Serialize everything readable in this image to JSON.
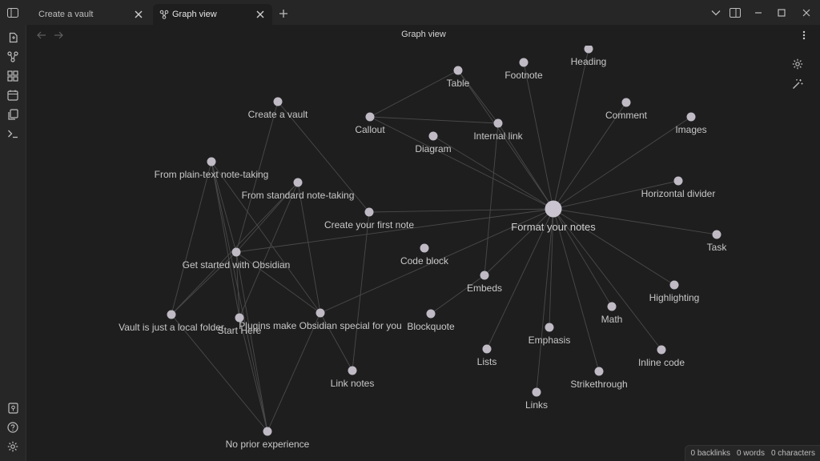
{
  "tabs": [
    {
      "label": "Create a vault",
      "active": false
    },
    {
      "label": "Graph view",
      "active": true
    }
  ],
  "view": {
    "title": "Graph view"
  },
  "icons": {
    "sidebar_toggle": "sidebar-toggle-icon",
    "graph_tab": "graph-icon",
    "ribbon": [
      "open-files-icon",
      "graph-icon",
      "canvas-icon",
      "calendar-icon",
      "copy-icon",
      "terminal-icon"
    ],
    "ribbon_bottom": [
      "vault-icon",
      "help-icon",
      "settings-icon"
    ]
  },
  "graph": {
    "hub": "Format your notes",
    "nodes": [
      {
        "id": "format",
        "label": "Format your notes"
      },
      {
        "id": "heading",
        "label": "Heading"
      },
      {
        "id": "footnote",
        "label": "Footnote"
      },
      {
        "id": "table",
        "label": "Table"
      },
      {
        "id": "comment",
        "label": "Comment"
      },
      {
        "id": "images",
        "label": "Images"
      },
      {
        "id": "callout",
        "label": "Callout"
      },
      {
        "id": "internal",
        "label": "Internal link"
      },
      {
        "id": "diagram",
        "label": "Diagram"
      },
      {
        "id": "createvault",
        "label": "Create a vault"
      },
      {
        "id": "plaintext",
        "label": "From plain-text note-taking"
      },
      {
        "id": "standard",
        "label": "From standard note-taking"
      },
      {
        "id": "firstnote",
        "label": "Create your first note"
      },
      {
        "id": "hdivider",
        "label": "Horizontal divider"
      },
      {
        "id": "task",
        "label": "Task"
      },
      {
        "id": "codeblock",
        "label": "Code block"
      },
      {
        "id": "getstarted",
        "label": "Get started with Obsidian"
      },
      {
        "id": "embeds",
        "label": "Embeds"
      },
      {
        "id": "highlighting",
        "label": "Highlighting"
      },
      {
        "id": "math",
        "label": "Math"
      },
      {
        "id": "vaultfolder",
        "label": "Vault is just a local folder"
      },
      {
        "id": "starthere",
        "label": "Start Here"
      },
      {
        "id": "plugins",
        "label": "Plugins make Obsidian special for you"
      },
      {
        "id": "blockquote",
        "label": "Blockquote"
      },
      {
        "id": "emphasis",
        "label": "Emphasis"
      },
      {
        "id": "lists",
        "label": "Lists"
      },
      {
        "id": "inlinecode",
        "label": "Inline code"
      },
      {
        "id": "linknotes",
        "label": "Link notes"
      },
      {
        "id": "strikethrough",
        "label": "Strikethrough"
      },
      {
        "id": "links",
        "label": "Links"
      },
      {
        "id": "noprior",
        "label": "No prior experience"
      }
    ],
    "edges": [
      [
        "format",
        "heading"
      ],
      [
        "format",
        "footnote"
      ],
      [
        "format",
        "table"
      ],
      [
        "format",
        "comment"
      ],
      [
        "format",
        "images"
      ],
      [
        "format",
        "callout"
      ],
      [
        "format",
        "internal"
      ],
      [
        "format",
        "diagram"
      ],
      [
        "format",
        "hdivider"
      ],
      [
        "format",
        "task"
      ],
      [
        "format",
        "embeds"
      ],
      [
        "format",
        "highlighting"
      ],
      [
        "format",
        "math"
      ],
      [
        "format",
        "emphasis"
      ],
      [
        "format",
        "lists"
      ],
      [
        "format",
        "inlinecode"
      ],
      [
        "format",
        "strikethrough"
      ],
      [
        "format",
        "links"
      ],
      [
        "format",
        "firstnote"
      ],
      [
        "format",
        "plugins"
      ],
      [
        "format",
        "getstarted"
      ],
      [
        "table",
        "callout"
      ],
      [
        "table",
        "internal"
      ],
      [
        "callout",
        "internal"
      ],
      [
        "internal",
        "embeds"
      ],
      [
        "embeds",
        "blockquote"
      ],
      [
        "createvault",
        "getstarted"
      ],
      [
        "createvault",
        "firstnote"
      ],
      [
        "plaintext",
        "getstarted"
      ],
      [
        "plaintext",
        "vaultfolder"
      ],
      [
        "plaintext",
        "starthere"
      ],
      [
        "plaintext",
        "plugins"
      ],
      [
        "plaintext",
        "noprior"
      ],
      [
        "standard",
        "getstarted"
      ],
      [
        "standard",
        "vaultfolder"
      ],
      [
        "standard",
        "starthere"
      ],
      [
        "standard",
        "plugins"
      ],
      [
        "firstnote",
        "linknotes"
      ],
      [
        "getstarted",
        "vaultfolder"
      ],
      [
        "getstarted",
        "starthere"
      ],
      [
        "getstarted",
        "noprior"
      ],
      [
        "getstarted",
        "plugins"
      ],
      [
        "vaultfolder",
        "noprior"
      ],
      [
        "starthere",
        "noprior"
      ],
      [
        "plugins",
        "noprior"
      ],
      [
        "plugins",
        "linknotes"
      ]
    ]
  },
  "status": {
    "backlinks": "0 backlinks",
    "words": "0 words",
    "characters": "0 characters"
  }
}
